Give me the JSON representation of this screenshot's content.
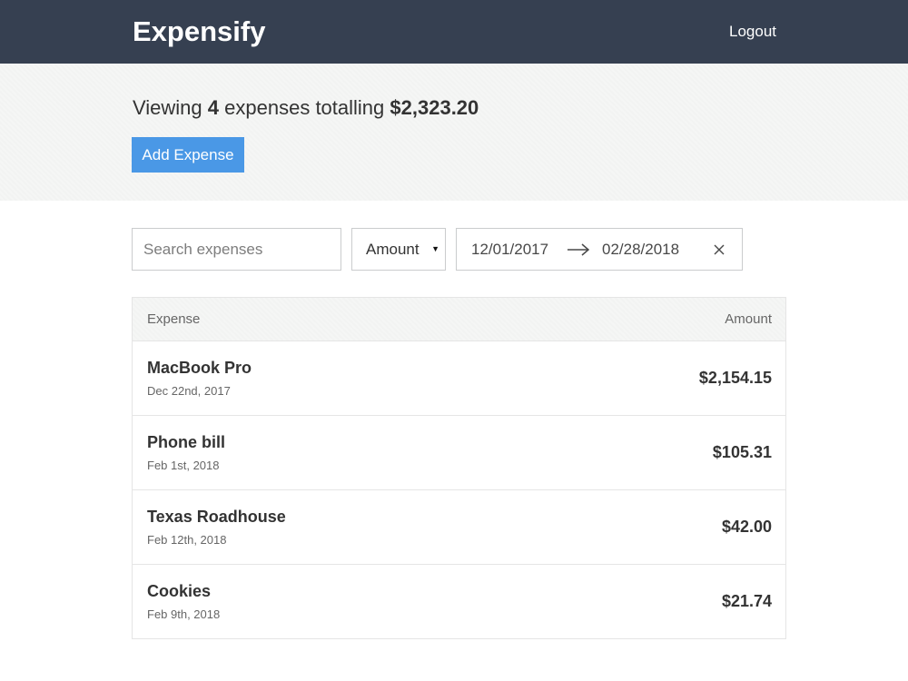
{
  "header": {
    "brand": "Expensify",
    "logout_label": "Logout"
  },
  "summary": {
    "prefix": "Viewing",
    "count": "4",
    "middle": "expenses totalling",
    "total": "$2,323.20",
    "add_button_label": "Add Expense"
  },
  "filters": {
    "search_placeholder": "Search expenses",
    "search_value": "",
    "sort_selected": "Amount",
    "start_date": "12/01/2017",
    "end_date": "02/28/2018"
  },
  "table": {
    "col_expense": "Expense",
    "col_amount": "Amount",
    "rows": [
      {
        "description": "MacBook Pro",
        "date": "Dec 22nd, 2017",
        "amount": "$2,154.15"
      },
      {
        "description": "Phone bill",
        "date": "Feb 1st, 2018",
        "amount": "$105.31"
      },
      {
        "description": "Texas Roadhouse",
        "date": "Feb 12th, 2018",
        "amount": "$42.00"
      },
      {
        "description": "Cookies",
        "date": "Feb 9th, 2018",
        "amount": "$21.74"
      }
    ]
  },
  "icons": {
    "sort_caret": "caret-down-icon",
    "date_arrow": "arrow-right-icon",
    "date_clear": "close-icon"
  },
  "colors": {
    "header_bg": "#364051",
    "button_bg": "#4a98e6",
    "summary_bg": "#f5f6f5"
  }
}
